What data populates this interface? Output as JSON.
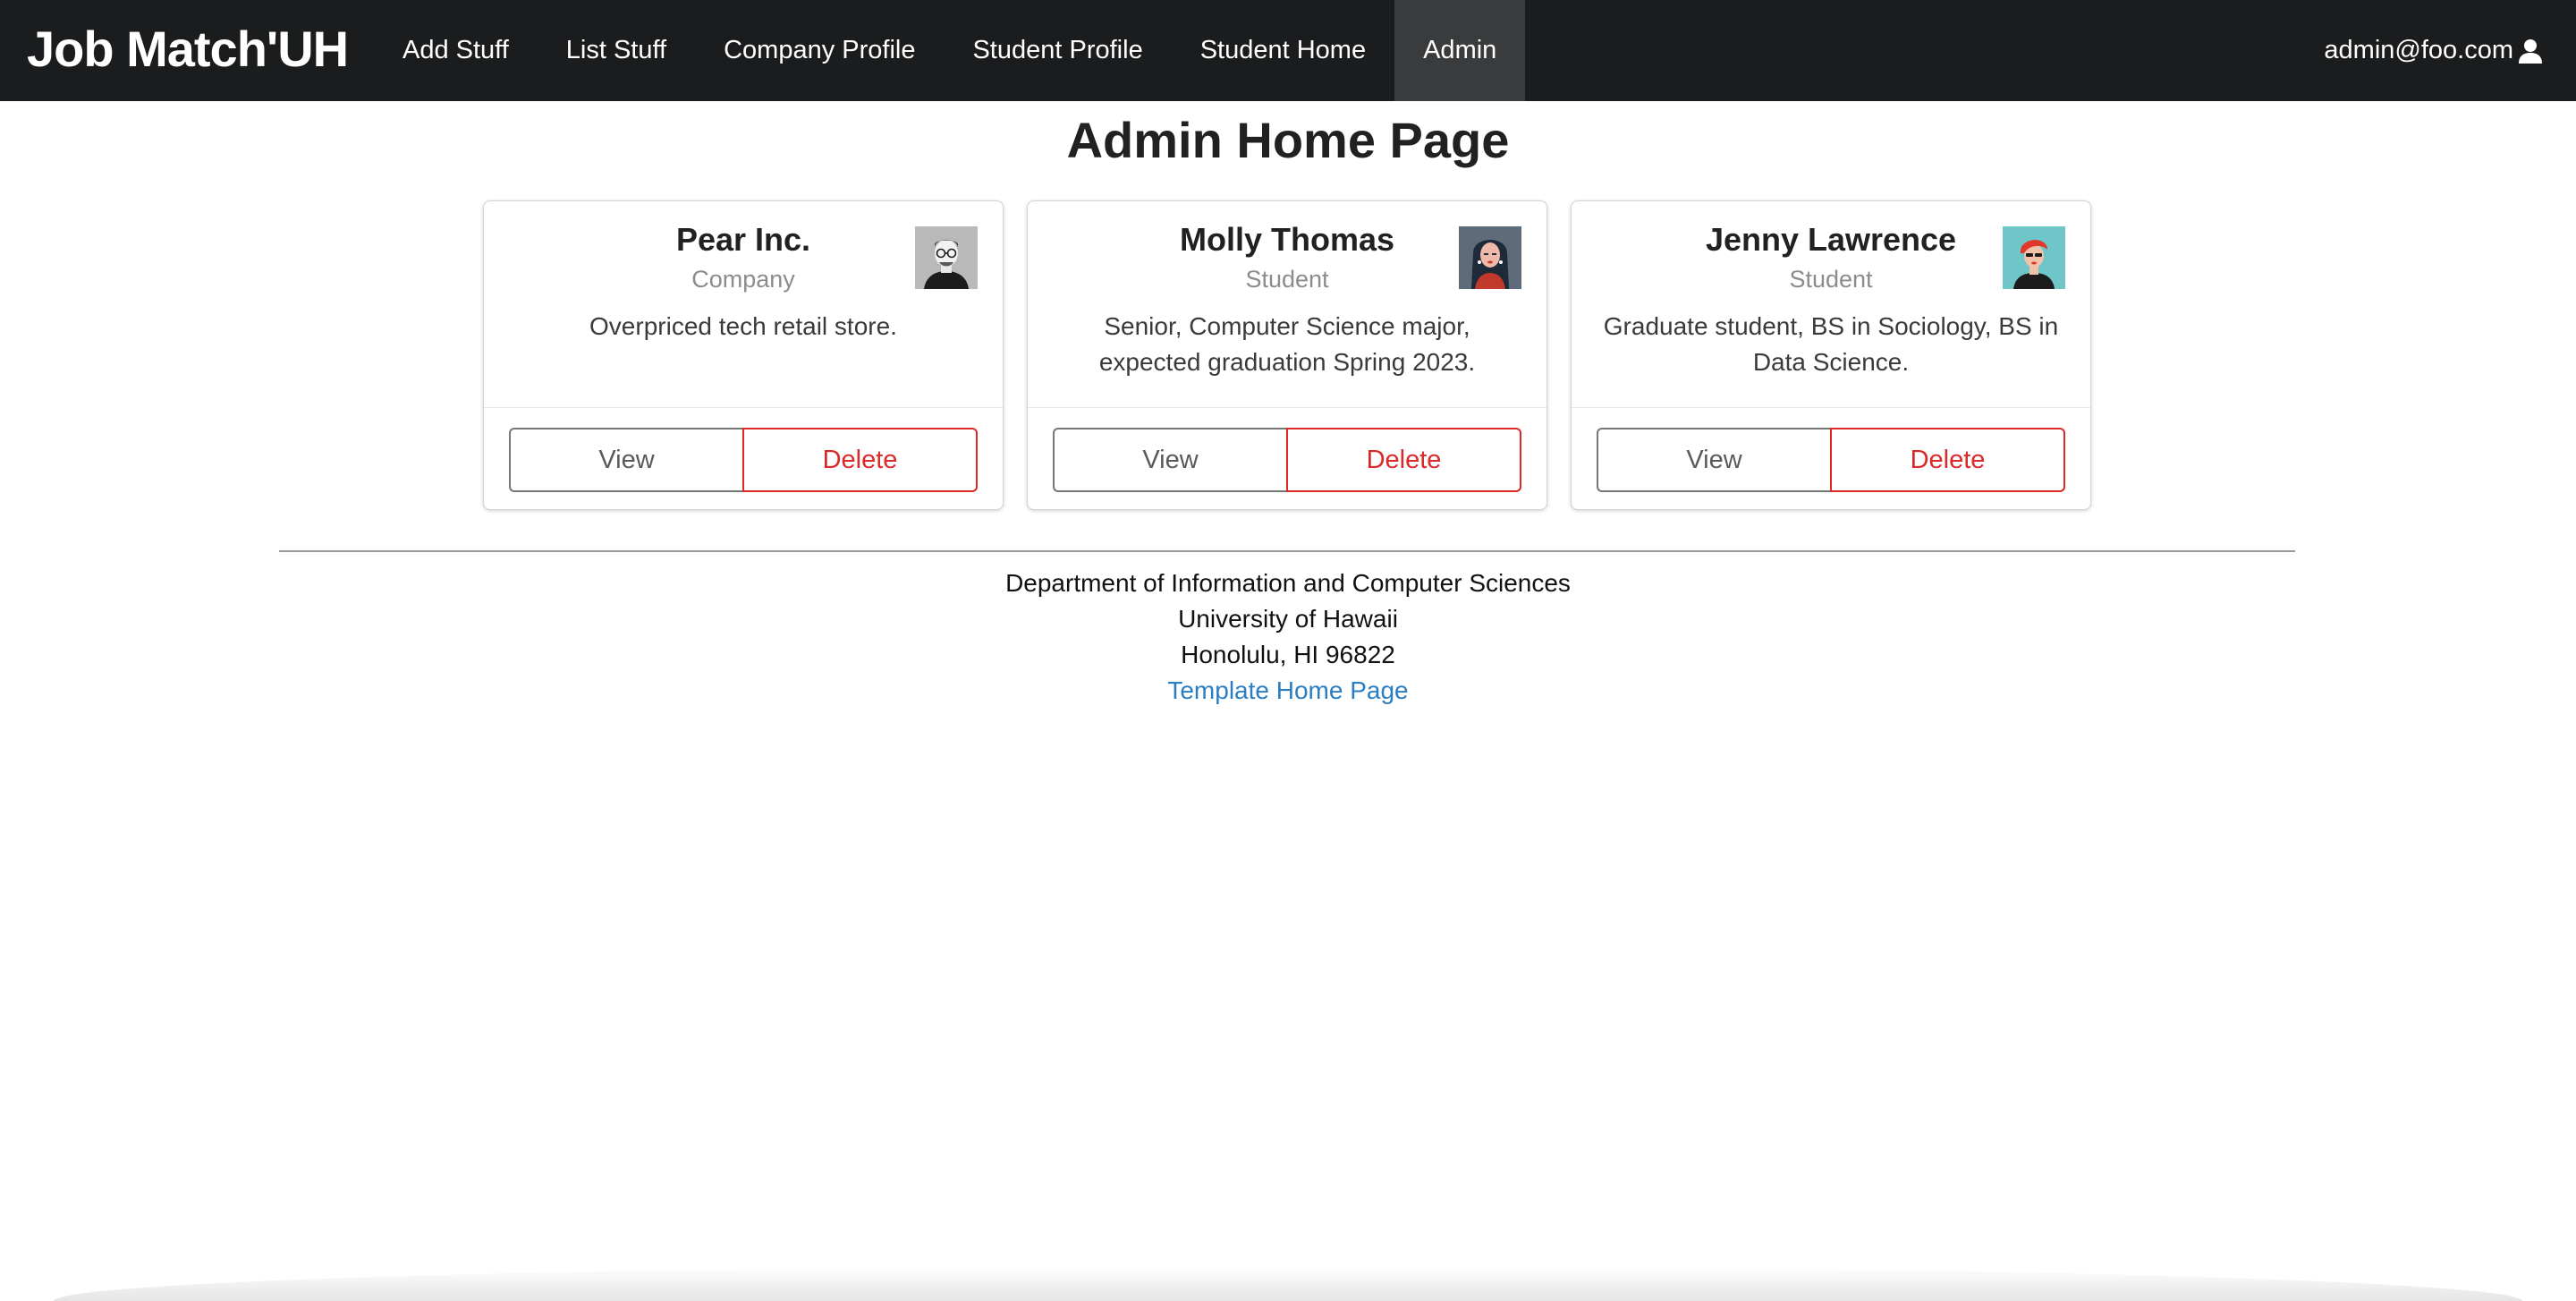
{
  "navbar": {
    "brand": "Job Match'UH",
    "items": [
      {
        "label": "Add Stuff",
        "active": false
      },
      {
        "label": "List Stuff",
        "active": false
      },
      {
        "label": "Company Profile",
        "active": false
      },
      {
        "label": "Student Profile",
        "active": false
      },
      {
        "label": "Student Home",
        "active": false
      },
      {
        "label": "Admin",
        "active": true
      }
    ],
    "user_email": "admin@foo.com",
    "user_icon": "user-icon"
  },
  "page": {
    "title": "Admin Home Page"
  },
  "cards": [
    {
      "name": "Pear Inc.",
      "type": "Company",
      "description": "Overpriced tech retail store.",
      "avatar": "avatar-man-glasses",
      "view_label": "View",
      "delete_label": "Delete"
    },
    {
      "name": "Molly Thomas",
      "type": "Student",
      "description": "Senior, Computer Science major, expected graduation Spring 2023.",
      "avatar": "avatar-woman-dark-hair",
      "view_label": "View",
      "delete_label": "Delete"
    },
    {
      "name": "Jenny Lawrence",
      "type": "Student",
      "description": "Graduate student, BS in Sociology, BS in Data Science.",
      "avatar": "avatar-woman-red-hair",
      "view_label": "View",
      "delete_label": "Delete"
    }
  ],
  "footer": {
    "line1": "Department of Information and Computer Sciences",
    "line2": "University of Hawaii",
    "line3": "Honolulu, HI 96822",
    "link_label": "Template Home Page"
  },
  "colors": {
    "navbar_bg": "#1b1c1d",
    "navbar_active": "#3a3b3c",
    "delete_red": "#db2828",
    "link_blue": "#2a7ec1"
  }
}
